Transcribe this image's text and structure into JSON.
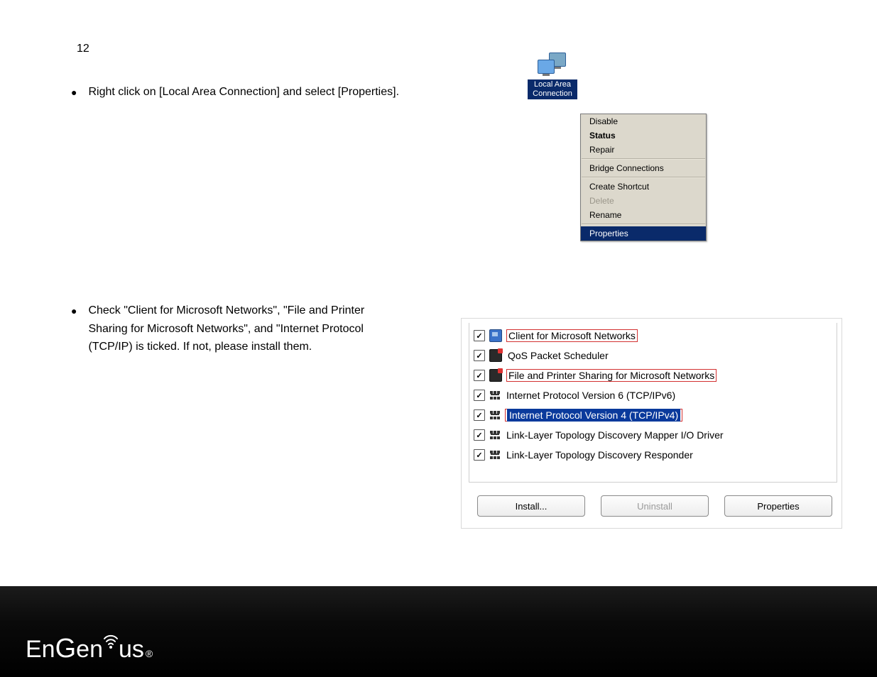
{
  "page_number": "12",
  "bullets": {
    "b1": "Right click on [Local Area Connection] and select [Properties].",
    "b2_line1": "Check \"Client for Microsoft Networks\", \"File and Printer",
    "b2_line2": "Sharing for Microsoft Networks\", and \"Internet Protocol",
    "b2_line3": "(TCP/IP) is ticked. If not, please install them."
  },
  "lac_icon_label_line1": "Local Area",
  "lac_icon_label_line2": "Connection",
  "context_menu": {
    "disable": "Disable",
    "status": "Status",
    "repair": "Repair",
    "bridge": "Bridge Connections",
    "create_shortcut": "Create Shortcut",
    "delete": "Delete",
    "rename": "Rename",
    "properties": "Properties"
  },
  "props_list": {
    "client_ms": "Client for Microsoft Networks",
    "qos": "QoS Packet Scheduler",
    "file_printer": "File and Printer Sharing for Microsoft Networks",
    "ipv6": "Internet Protocol Version 6 (TCP/IPv6)",
    "ipv4": "Internet Protocol Version 4 (TCP/IPv4)",
    "lltd_mapper": "Link-Layer Topology Discovery Mapper I/O Driver",
    "lltd_responder": "Link-Layer Topology Discovery Responder"
  },
  "buttons": {
    "install": "Install...",
    "uninstall": "Uninstall",
    "properties": "Properties"
  },
  "brand": {
    "en": "En",
    "g": "G",
    "en2": "en",
    "ius": "us",
    "reg": "®"
  }
}
